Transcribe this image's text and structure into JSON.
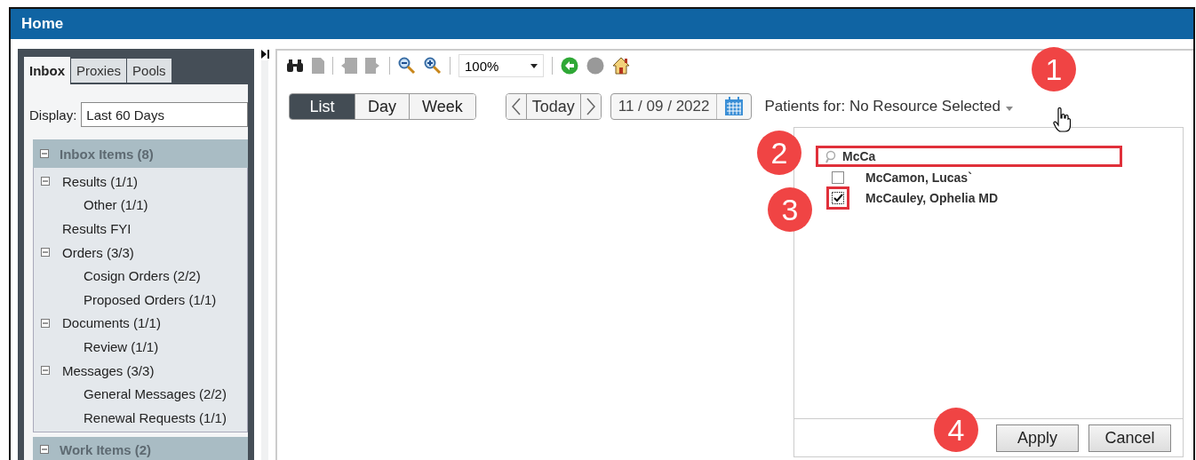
{
  "window": {
    "title": "Home"
  },
  "left_panel": {
    "tabs": [
      {
        "label": "Inbox",
        "selected": true
      },
      {
        "label": "Proxies",
        "selected": false
      },
      {
        "label": "Pools",
        "selected": false
      }
    ],
    "display": {
      "label": "Display:",
      "value": "Last 60 Days"
    },
    "sections": [
      {
        "title": "Inbox Items (8)",
        "expanded": true,
        "items": [
          {
            "label": "Results (1/1)",
            "expanded": true,
            "children": [
              {
                "label": "Other (1/1)"
              }
            ]
          },
          {
            "label": "Results FYI"
          },
          {
            "label": "Orders (3/3)",
            "expanded": true,
            "children": [
              {
                "label": "Cosign Orders (2/2)"
              },
              {
                "label": "Proposed Orders (1/1)"
              }
            ]
          },
          {
            "label": "Documents (1/1)",
            "expanded": true,
            "children": [
              {
                "label": "Review (1/1)"
              }
            ]
          },
          {
            "label": "Messages (3/3)",
            "expanded": true,
            "children": [
              {
                "label": "General Messages (2/2)"
              },
              {
                "label": "Renewal Requests (1/1)"
              }
            ]
          }
        ]
      },
      {
        "title": "Work Items (2)",
        "expanded": true
      }
    ]
  },
  "toolbar": {
    "zoom": "100%"
  },
  "views": [
    {
      "label": "List",
      "selected": true
    },
    {
      "label": "Day",
      "selected": false
    },
    {
      "label": "Week",
      "selected": false
    }
  ],
  "nav": {
    "today": "Today"
  },
  "date": "11 / 09 / 2022",
  "patients_for": "Patients for: No Resource Selected",
  "dropdown": {
    "search": {
      "value": "McCa",
      "highlighted": true
    },
    "options": [
      {
        "label": "McCamon, Lucas`",
        "checked": false,
        "highlighted": false
      },
      {
        "label": "McCauley, Ophelia MD",
        "checked": true,
        "highlighted": true
      }
    ],
    "buttons": [
      "Apply",
      "Cancel"
    ]
  },
  "callouts": [
    "1",
    "2",
    "3",
    "4"
  ]
}
